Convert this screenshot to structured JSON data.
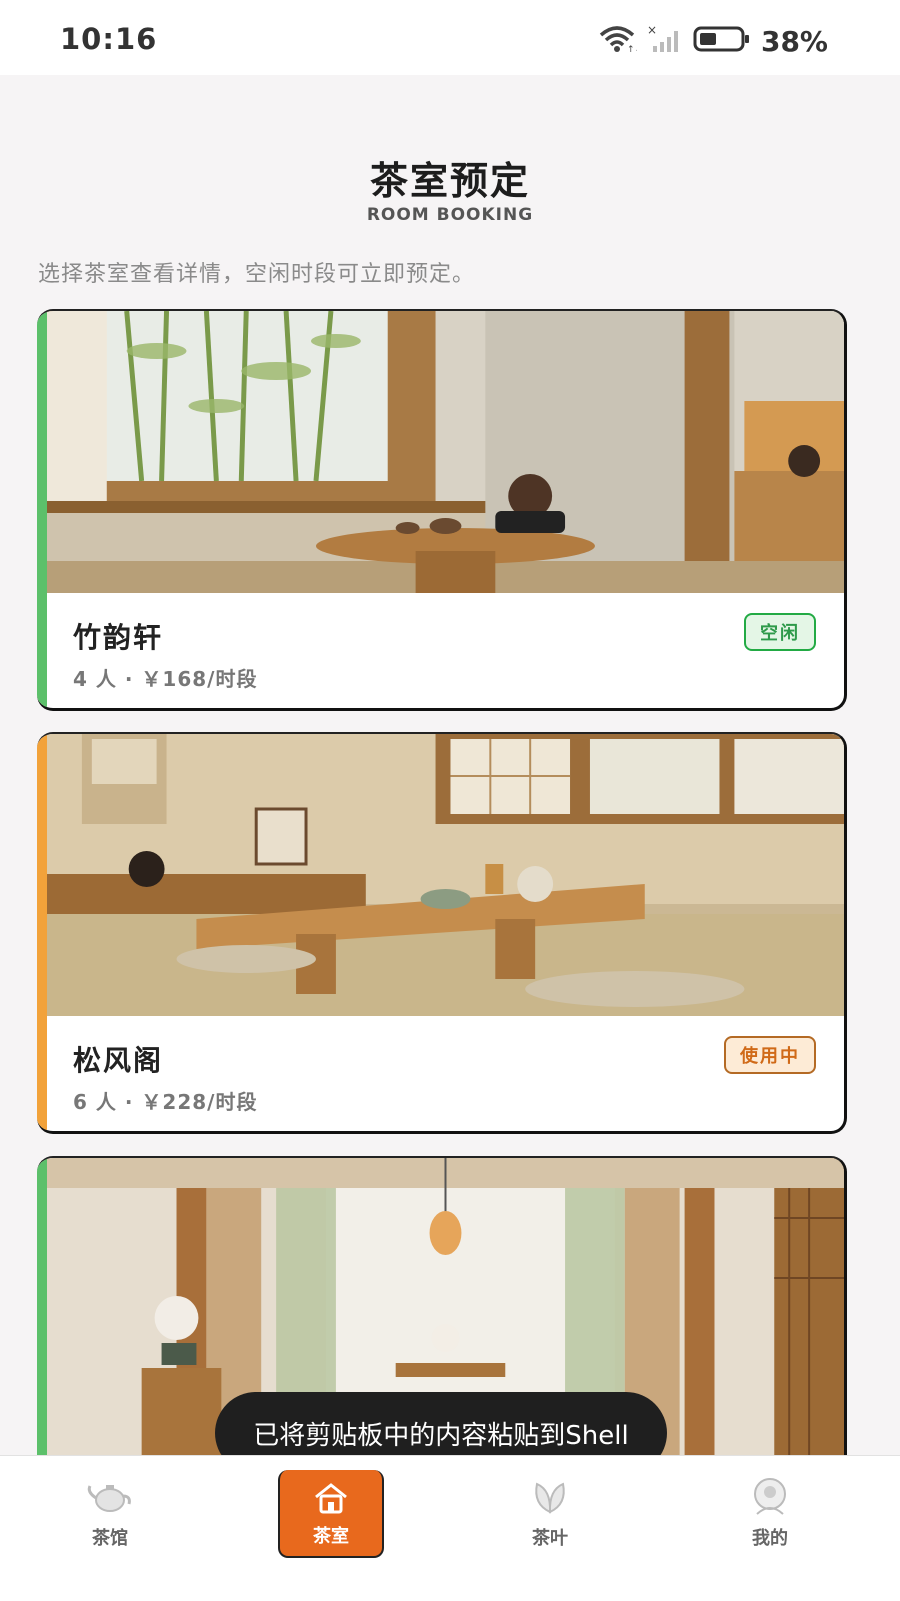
{
  "status_bar": {
    "time": "10:16",
    "battery": "38%"
  },
  "header": {
    "title": "茶室预定",
    "subtitle": "ROOM BOOKING",
    "intro": "选择茶室查看详情，空闲时段可立即预定。"
  },
  "rooms": [
    {
      "name": "竹韵轩",
      "meta": "4 人 · ￥168/时段",
      "status": "空闲",
      "accent": "#5cc06a"
    },
    {
      "name": "松风阁",
      "meta": "6 人 · ￥228/时段",
      "status": "使用中",
      "accent": "#f2a23a"
    },
    {
      "name": "",
      "meta": "",
      "status": "",
      "accent": "#5cc06a"
    }
  ],
  "toast": "已将剪贴板中的内容粘贴到Shell",
  "nav": {
    "items": [
      "茶馆",
      "茶室",
      "茶叶",
      "我的"
    ],
    "active": "茶室"
  },
  "icons": [
    "wifi-icon",
    "signal-icon",
    "battery-icon",
    "teapot-icon",
    "home-icon",
    "leaf-icon",
    "profile-icon"
  ]
}
